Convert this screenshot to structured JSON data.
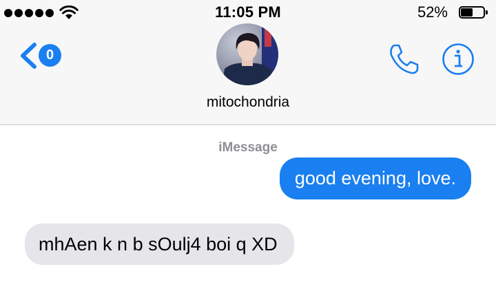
{
  "status_bar": {
    "time": "11:05 PM",
    "battery_percent": "52%",
    "battery_level": 0.52,
    "signal_bars": 5,
    "icons": [
      "signal-dots-icon",
      "wifi-icon",
      "battery-icon"
    ]
  },
  "nav": {
    "back_badge": "0",
    "contact_name": "mitochondria",
    "icons": [
      "back-chevron-icon",
      "phone-icon",
      "info-icon"
    ]
  },
  "thread": {
    "service_label": "iMessage",
    "messages": [
      {
        "direction": "outgoing",
        "text": "good evening, love."
      },
      {
        "direction": "incoming",
        "text": "mhAen k n b sOulj4 boi q XD"
      }
    ]
  },
  "colors": {
    "accent": "#1a7ff0",
    "incoming_bubble": "#e5e5ea",
    "header_bg": "#f7f7f7",
    "service_label": "#8e8e93"
  }
}
